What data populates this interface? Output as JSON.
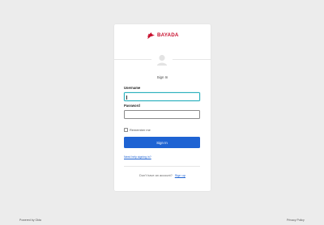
{
  "brand": {
    "name": "BAYADA",
    "accent": "#c8102e"
  },
  "title": "Sign In",
  "form": {
    "username_label": "Username",
    "username_value": "",
    "password_label": "Password",
    "password_value": "",
    "remember_label": "Remember me",
    "remember_checked": false,
    "submit_label": "Sign In",
    "submit_color": "#1e63d3"
  },
  "help_link": "Need help signing in?",
  "signup": {
    "prompt": "Don't have an account?",
    "link_label": "Sign up"
  },
  "footer": {
    "powered_by": "Powered by Okta",
    "privacy": "Privacy Policy"
  },
  "icons": {
    "logo": "dove-icon",
    "avatar": "user-avatar-icon"
  }
}
